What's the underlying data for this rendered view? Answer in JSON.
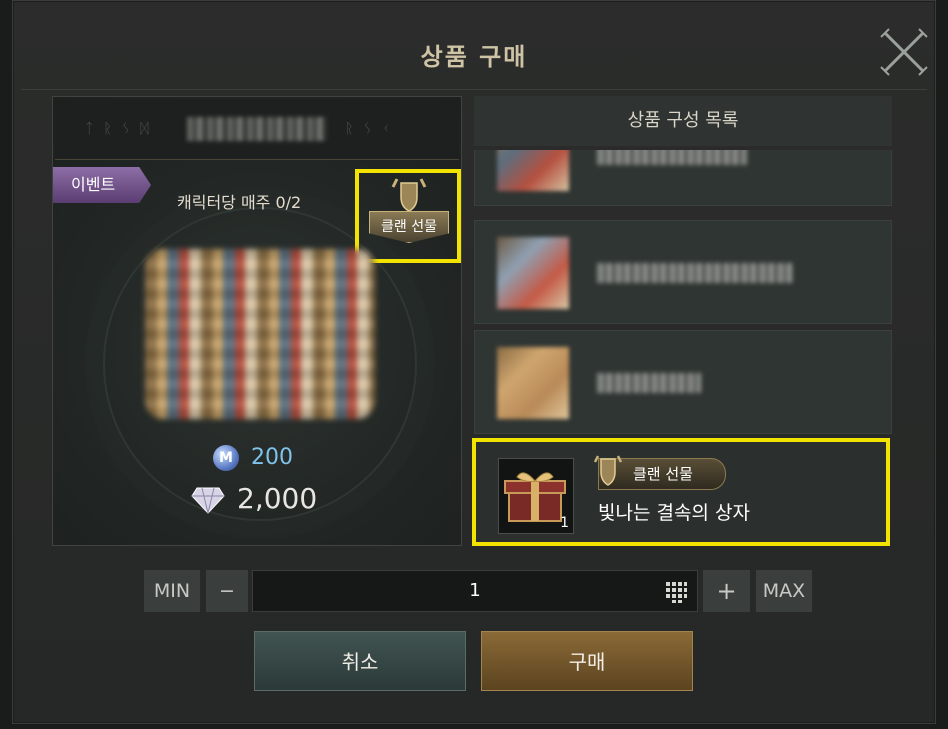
{
  "dialog": {
    "title": "상품 구매"
  },
  "product": {
    "event_tag": "이벤트",
    "purchase_limit": "캐릭터당 매주 0/2",
    "clan_gift_badge": "클랜 선물",
    "price_coin_value": "200",
    "price_coin_icon": "m-coin-icon",
    "price_diamond_value": "2,000",
    "price_diamond_icon": "diamond-icon"
  },
  "composition": {
    "header": "상품 구성 목록",
    "highlighted_item": {
      "badge": "클랜 선물",
      "name": "빛나는 결속의 상자",
      "quantity": "1"
    }
  },
  "quantity": {
    "min_label": "MIN",
    "minus_label": "−",
    "value": "1",
    "plus_label": "+",
    "max_label": "MAX"
  },
  "actions": {
    "cancel_label": "취소",
    "buy_label": "구매"
  },
  "colors": {
    "highlight": "#f2e300",
    "event_tag": "#7a5a96",
    "coin_price": "#7fc3ec"
  }
}
